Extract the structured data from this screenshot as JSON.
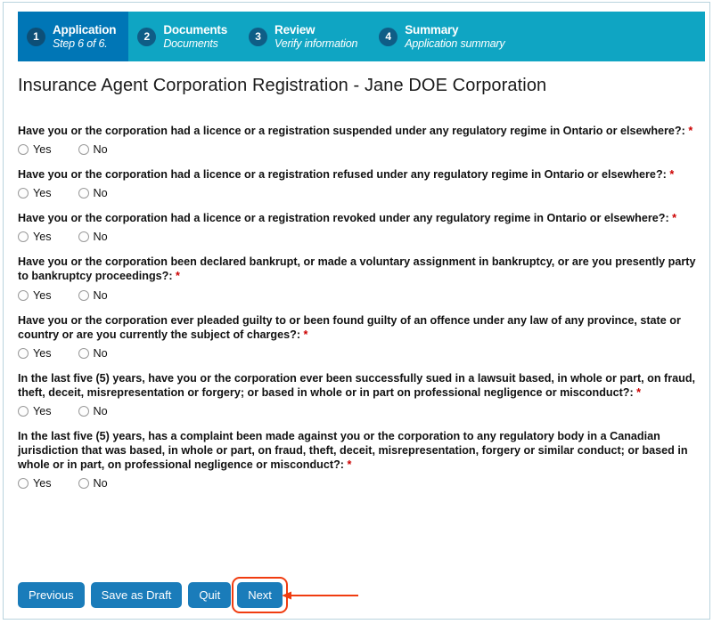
{
  "stepper": {
    "steps": [
      {
        "num": "1",
        "title": "Application",
        "sub": "Step 6 of 6.",
        "active": true
      },
      {
        "num": "2",
        "title": "Documents",
        "sub": "Documents",
        "active": false
      },
      {
        "num": "3",
        "title": "Review",
        "sub": "Verify information",
        "active": false
      },
      {
        "num": "4",
        "title": "Summary",
        "sub": "Application summary",
        "active": false
      }
    ],
    "active_bg": "#0076b6",
    "bar_bg": "#0fa5c3"
  },
  "page_title": "Insurance Agent Corporation Registration - Jane DOE Corporation",
  "questions": [
    {
      "text": "Have you or the corporation had a licence or a registration suspended under any regulatory regime in Ontario or elsewhere?:",
      "required_marker": "*",
      "options": [
        {
          "label": "Yes",
          "selected": false
        },
        {
          "label": "No",
          "selected": false
        }
      ]
    },
    {
      "text": "Have you or the corporation had a licence or a registration refused under any regulatory regime in Ontario or elsewhere?:",
      "required_marker": "*",
      "options": [
        {
          "label": "Yes",
          "selected": false
        },
        {
          "label": "No",
          "selected": false
        }
      ]
    },
    {
      "text": "Have you or the corporation had a licence or a registration revoked under any regulatory regime in Ontario or elsewhere?:",
      "required_marker": "*",
      "options": [
        {
          "label": "Yes",
          "selected": false
        },
        {
          "label": "No",
          "selected": false
        }
      ]
    },
    {
      "text": "Have you or the corporation been declared bankrupt, or made a voluntary assignment in bankruptcy, or are you presently party to bankruptcy proceedings?:",
      "required_marker": "*",
      "options": [
        {
          "label": "Yes",
          "selected": false
        },
        {
          "label": "No",
          "selected": false
        }
      ]
    },
    {
      "text": "Have you or the corporation ever pleaded guilty to or been found guilty of an offence under any law of any province, state or country or are you currently the subject of charges?:",
      "required_marker": "*",
      "options": [
        {
          "label": "Yes",
          "selected": false
        },
        {
          "label": "No",
          "selected": false
        }
      ]
    },
    {
      "text": "In the last five (5) years, have you or the corporation ever been successfully sued in a lawsuit based, in whole or part, on fraud, theft, deceit, misrepresentation or forgery; or based in whole or in part on professional negligence or misconduct?:",
      "required_marker": "*",
      "options": [
        {
          "label": "Yes",
          "selected": false
        },
        {
          "label": "No",
          "selected": false
        }
      ]
    },
    {
      "text": "In the last five (5) years, has a complaint been made against you or the corporation to any regulatory body in a Canadian jurisdiction that was based, in whole or part, on fraud, theft, deceit, misrepresentation, forgery or similar conduct; or based in whole or in part, on professional negligence or misconduct?:",
      "required_marker": "*",
      "options": [
        {
          "label": "Yes",
          "selected": false
        },
        {
          "label": "No",
          "selected": false
        }
      ]
    }
  ],
  "buttons": {
    "previous": "Previous",
    "save_as_draft": "Save as Draft",
    "quit": "Quit",
    "next": "Next"
  },
  "annotation": {
    "highlight_color": "#f03c10",
    "target": "Next"
  }
}
